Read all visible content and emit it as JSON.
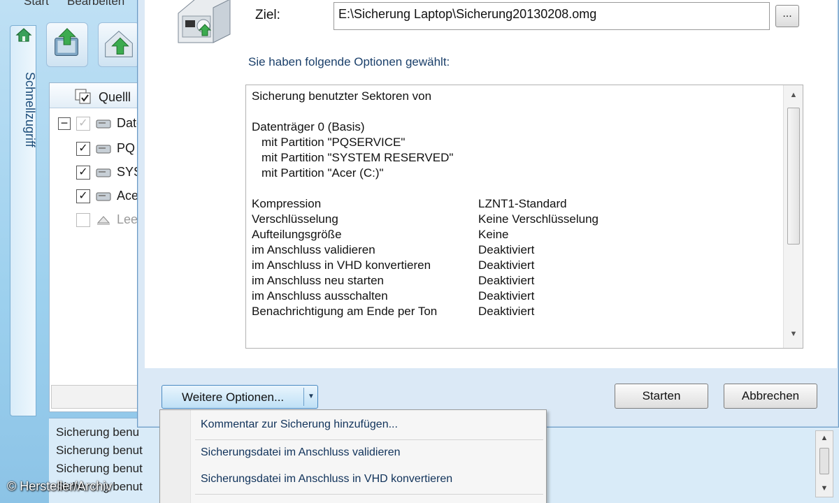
{
  "background_app": {
    "menu": [
      "Start",
      "Bearbeiten"
    ],
    "side_tab_label": "Schnellzugriff",
    "panel_header": "Quelll",
    "tree_items": [
      {
        "label": "Date",
        "checked": true,
        "disabled": true,
        "expander": "−"
      },
      {
        "label": "PQ",
        "checked": true,
        "disabled": false
      },
      {
        "label": "SYS",
        "checked": true,
        "disabled": false
      },
      {
        "label": "Ace",
        "checked": true,
        "disabled": false
      },
      {
        "label": "Lee",
        "checked": false,
        "disabled": true
      }
    ],
    "status_lines": [
      "Sicherung benu",
      "Sicherung benut",
      "Sicherung benut",
      "Sicherung benut"
    ]
  },
  "dialog": {
    "ziel_label": "Ziel:",
    "ziel_value": "E:\\Sicherung Laptop\\Sicherung20130208.omg",
    "browse_label": "...",
    "options_heading": "Sie haben folgende Optionen gewählt:",
    "summary": {
      "intro": "Sicherung benutzter Sektoren von",
      "disk": "Datenträger 0 (Basis)",
      "partitions": [
        "mit Partition \"PQSERVICE\"",
        "mit Partition \"SYSTEM RESERVED\"",
        "mit Partition \"Acer (C:)\""
      ],
      "options": [
        {
          "key": "Kompression",
          "value": "LZNT1-Standard"
        },
        {
          "key": "Verschlüsselung",
          "value": "Keine Verschlüsselung"
        },
        {
          "key": "Aufteilungsgröße",
          "value": "Keine"
        },
        {
          "key": "im Anschluss validieren",
          "value": "Deaktiviert"
        },
        {
          "key": "im Anschluss in VHD konvertieren",
          "value": "Deaktiviert"
        },
        {
          "key": "im Anschluss neu starten",
          "value": "Deaktiviert"
        },
        {
          "key": "im Anschluss ausschalten",
          "value": "Deaktiviert"
        },
        {
          "key": "Benachrichtigung am Ende per Ton",
          "value": "Deaktiviert"
        }
      ]
    },
    "more_options_label": "Weitere Optionen...",
    "start_label": "Starten",
    "cancel_label": "Abbrechen"
  },
  "dropdown": {
    "items": [
      "Kommentar zur Sicherung hinzufügen...",
      "Sicherungsdatei im Anschluss validieren",
      "Sicherungsdatei im Anschluss in VHD konvertieren"
    ]
  },
  "watermark": "© Hersteller/Archiv",
  "icons": {
    "home": "home-icon",
    "backup": "backup-drive-icon",
    "restore": "restore-drive-icon",
    "disk": "disk-icon",
    "scroll_up": "scroll-up-icon",
    "scroll_down": "scroll-down-icon",
    "dropdown": "chevron-down-icon"
  },
  "colors": {
    "accent": "#8ec6e8",
    "dialog_frame": "#dbe9f6",
    "heading_text": "#1a3f6a",
    "menu_text": "#10325a"
  }
}
